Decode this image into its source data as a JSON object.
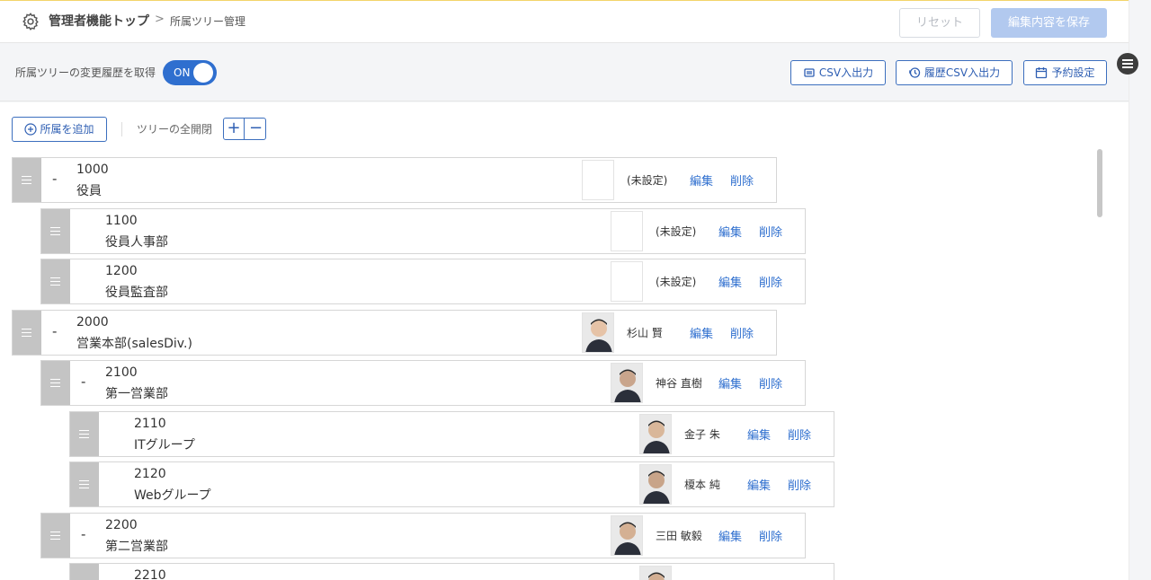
{
  "header": {
    "title": "管理者機能トップ",
    "separator": ">",
    "breadcrumb": "所属ツリー管理",
    "reset_label": "リセット",
    "save_label": "編集内容を保存"
  },
  "toolbar": {
    "history_label": "所属ツリーの変更履歴を取得",
    "toggle_label": "ON",
    "csv_label": "CSV入出力",
    "history_csv_label": "履歴CSV入出力",
    "schedule_label": "予約設定"
  },
  "tree_tools": {
    "add_label": "所属を追加",
    "expand_label": "ツリーの全開閉",
    "plus": "+",
    "minus": "−"
  },
  "actions": {
    "edit": "編集",
    "delete": "削除"
  },
  "colors": {
    "accent": "#2f6fcf",
    "handle": "#c4c4c4",
    "save_disabled": "#b2c9ef"
  },
  "rows": [
    {
      "level": 0,
      "collapsible": true,
      "dash": "-",
      "code": "1000",
      "name": "役員",
      "person": "(未設定)",
      "photo": false
    },
    {
      "level": 1,
      "collapsible": false,
      "dash": "",
      "code": "1100",
      "name": "役員人事部",
      "person": "(未設定)",
      "photo": false
    },
    {
      "level": 1,
      "collapsible": false,
      "dash": "",
      "code": "1200",
      "name": "役員監査部",
      "person": "(未設定)",
      "photo": false
    },
    {
      "level": 0,
      "collapsible": true,
      "dash": "-",
      "code": "2000",
      "name": "営業本部(salesDiv.)",
      "person": "杉山 賢",
      "photo": true
    },
    {
      "level": 1,
      "collapsible": true,
      "dash": "-",
      "code": "2100",
      "name": "第一営業部",
      "person": "神谷 直樹",
      "photo": true
    },
    {
      "level": 2,
      "collapsible": false,
      "dash": "",
      "code": "2110",
      "name": "ITグループ",
      "person": "金子 朱",
      "photo": true
    },
    {
      "level": 2,
      "collapsible": false,
      "dash": "",
      "code": "2120",
      "name": "Webグループ",
      "person": "榎本 純",
      "photo": true
    },
    {
      "level": 1,
      "collapsible": true,
      "dash": "-",
      "code": "2200",
      "name": "第二営業部",
      "person": "三田 敏毅",
      "photo": true
    },
    {
      "level": 2,
      "collapsible": false,
      "dash": "",
      "code": "2210",
      "name": "",
      "person": "",
      "photo": true
    }
  ]
}
